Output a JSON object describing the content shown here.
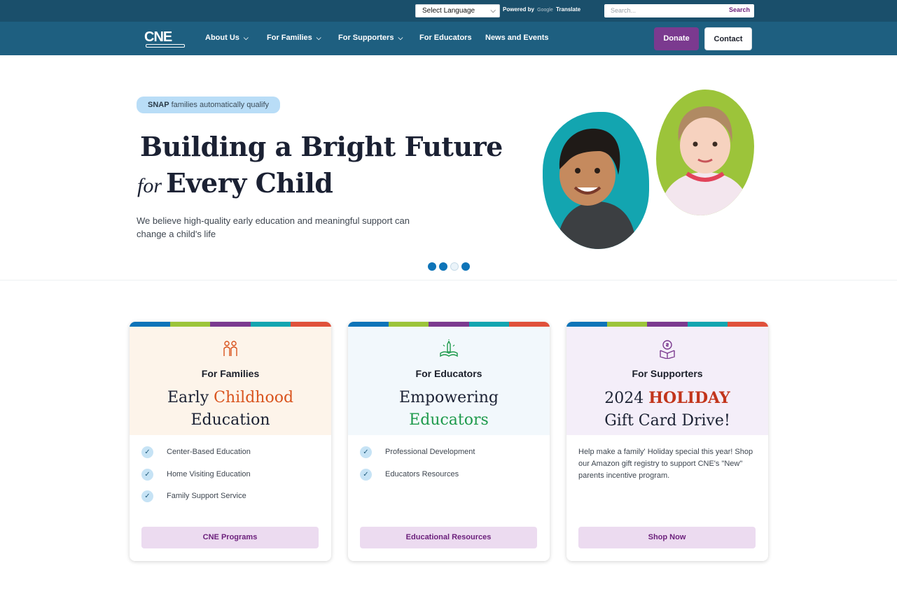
{
  "utility": {
    "language_select": "Select Language",
    "powered_by": "Powered by",
    "google": "Google",
    "translate": "Translate",
    "search_placeholder": "Search...",
    "search_button": "Search"
  },
  "nav": {
    "logo": "CNE",
    "items": [
      {
        "label": "About Us"
      },
      {
        "label": "For Families"
      },
      {
        "label": "For Supporters"
      },
      {
        "label": "For Educators"
      },
      {
        "label": "News and Events"
      }
    ],
    "donate": "Donate",
    "contact": "Contact"
  },
  "hero": {
    "badge_bold": "SNAP",
    "badge_rest": "families automatically qualify",
    "title_line1": "Building a Bright Future",
    "title_script": "for",
    "title_line2": "Every Child",
    "subtitle": "We believe high-quality early education and meaningful support can change a child's life",
    "dots": [
      true,
      true,
      false,
      true
    ]
  },
  "cards": [
    {
      "kicker": "For Families",
      "head_a": "Early ",
      "head_b": "Childhood",
      "head_c": "Education",
      "items": [
        "Center-Based Education",
        "Home Visiting Education",
        "Family Support Service"
      ],
      "button": "CNE Programs"
    },
    {
      "kicker": "For Educators",
      "head_a": "Empowering",
      "head_b": "Educators",
      "items": [
        "Professional Development",
        "Educators Resources"
      ],
      "button": "Educational Resources"
    },
    {
      "kicker": "For Supporters",
      "head_a": "2024 ",
      "head_b": "HOLIDAY",
      "head_c": "Gift Card Drive!",
      "text": "Help make a family' Holiday special this year! Shop our Amazon gift registry to support CNE's \"New\" parents incentive program.",
      "button": "Shop Now"
    }
  ],
  "colors": {
    "utility_bar": "#1a4f6b",
    "nav_bar": "#1e5f80",
    "donate": "#7b3a8f",
    "accent_orange": "#d9541e",
    "accent_green": "#1e9a4c",
    "accent_red": "#c2351c",
    "stripe": [
      "#0e74b8",
      "#9cc43a",
      "#7b3a8f",
      "#13a5b0",
      "#e0513b"
    ]
  }
}
